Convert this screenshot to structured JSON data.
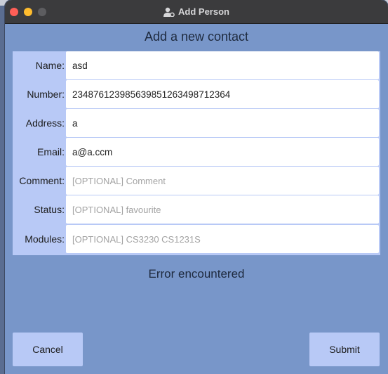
{
  "window": {
    "title": "Add Person",
    "title_icon": "person-gear-icon"
  },
  "heading": "Add a new contact",
  "form": {
    "fields": [
      {
        "label": "Name:",
        "value": "asd",
        "placeholder": ""
      },
      {
        "label": "Number:",
        "value": "234876123985639851263498712364",
        "placeholder": ""
      },
      {
        "label": "Address:",
        "value": "a",
        "placeholder": ""
      },
      {
        "label": "Email:",
        "value": "a@a.ccm",
        "placeholder": ""
      },
      {
        "label": "Comment:",
        "value": "",
        "placeholder": "[OPTIONAL] Comment"
      },
      {
        "label": "Status:",
        "value": "",
        "placeholder": "[OPTIONAL] favourite"
      },
      {
        "label": "Modules:",
        "value": "",
        "placeholder": "[OPTIONAL] CS3230 CS1231S"
      }
    ]
  },
  "status_message": "Error encountered",
  "buttons": {
    "cancel": "Cancel",
    "submit": "Submit"
  },
  "colors": {
    "window_bg": "#7896c9",
    "panel_bg": "#b8c9f6",
    "titlebar": "#3b3b3d"
  }
}
